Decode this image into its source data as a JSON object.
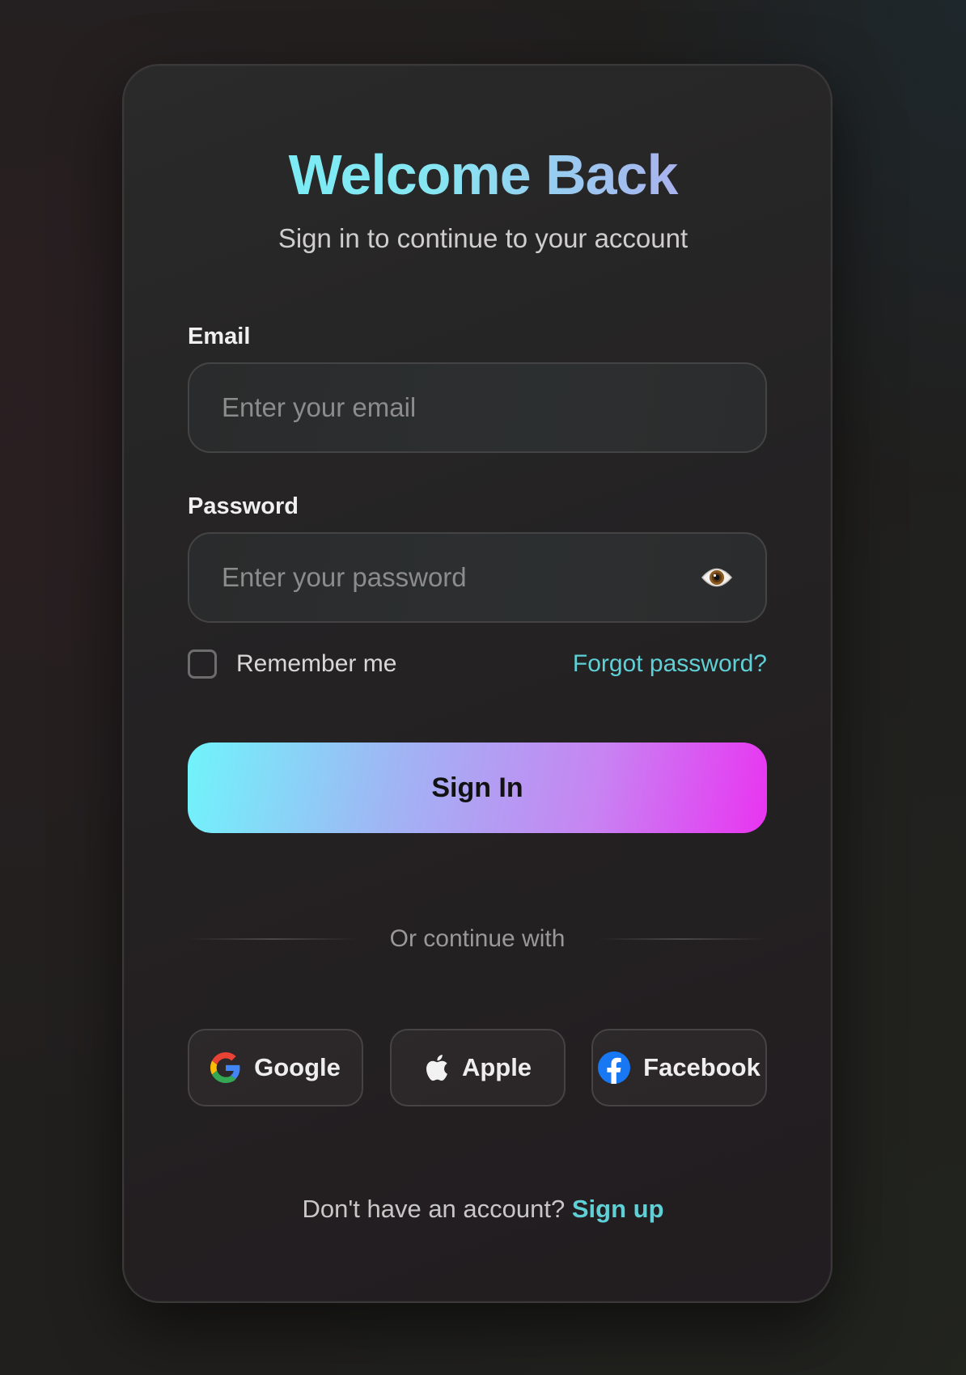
{
  "header": {
    "title": "Welcome Back",
    "subtitle": "Sign in to continue to your account"
  },
  "form": {
    "email": {
      "label": "Email",
      "value": "",
      "placeholder": "Enter your email"
    },
    "password": {
      "label": "Password",
      "value": "",
      "placeholder": "Enter your password",
      "toggle_icon": "eye-icon"
    },
    "remember": {
      "label": "Remember me",
      "checked": false
    },
    "forgot_label": "Forgot password?",
    "submit_label": "Sign In"
  },
  "divider_text": "Or continue with",
  "socials": [
    {
      "label": "Google",
      "icon": "google-icon"
    },
    {
      "label": "Apple",
      "icon": "apple-icon"
    },
    {
      "label": "Facebook",
      "icon": "facebook-icon"
    }
  ],
  "footer": {
    "prompt": "Don't have an account?",
    "link": "Sign up"
  },
  "colors": {
    "accent": "#5fd0d6",
    "gradient_start": "#70f4fb",
    "gradient_end": "#e934f1",
    "background": "#201f1e"
  }
}
